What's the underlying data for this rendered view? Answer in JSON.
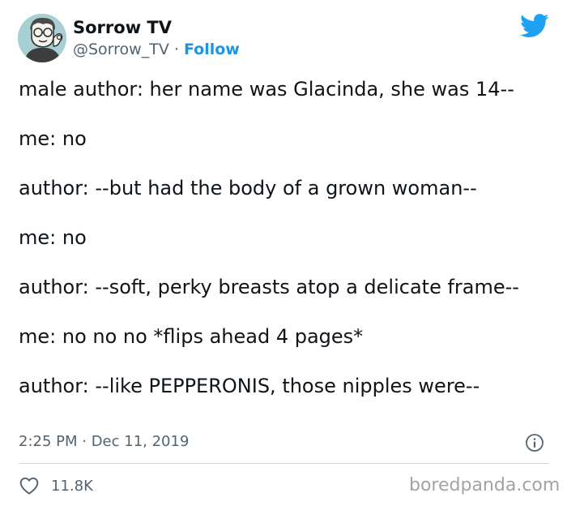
{
  "user": {
    "display_name": "Sorrow TV",
    "handle": "@Sorrow_TV",
    "separator": " · ",
    "follow_label": "Follow"
  },
  "tweet": {
    "lines": [
      "male author: her name was Glacinda, she was 14--",
      "me: no",
      "author: --but had the body of a grown woman--",
      "me: no",
      "author: --soft, perky breasts atop a delicate frame--",
      "me: no no no *flips ahead 4 pages*",
      "author: --like PEPPERONIS, those nipples were--"
    ],
    "timestamp": "2:25 PM · Dec 11, 2019"
  },
  "actions": {
    "like_count": "11.8K"
  },
  "icons": {
    "brand": "twitter-bird-icon",
    "info": "info-icon",
    "like": "heart-icon"
  },
  "colors": {
    "brand_blue": "#1da1f2",
    "follow_link": "#1b95e0",
    "secondary_text": "#536471"
  },
  "watermark": "boredpanda.com"
}
